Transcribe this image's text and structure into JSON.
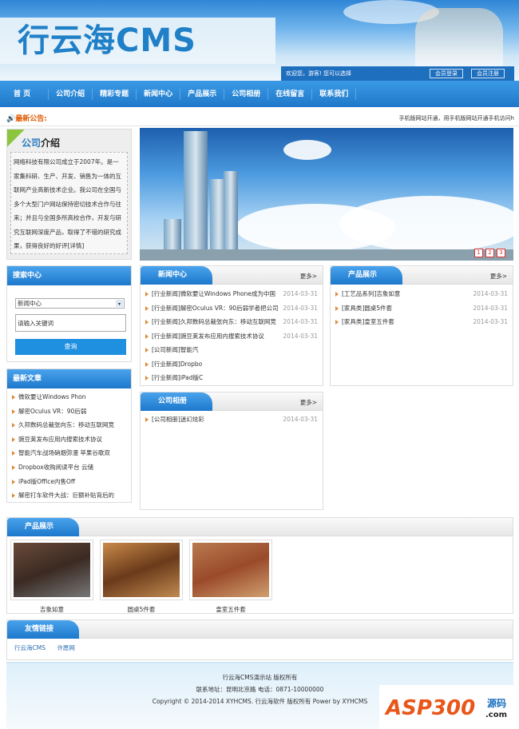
{
  "header": {
    "logo": "行云海CMS",
    "welcome": "欢迎您，游客! 您可以选择",
    "login": "会员登录",
    "register": "会员注册"
  },
  "nav": [
    "首 页",
    "公司介绍",
    "精彩专题",
    "新闻中心",
    "产品展示",
    "公司相册",
    "在线留言",
    "联系我们"
  ],
  "notice": {
    "label": "最新公告:",
    "text": "手机版网站开通，用手机版网站开通手机访问h"
  },
  "intro": {
    "title_a": "公司",
    "title_b": "介绍",
    "body": "网络科技有限公司成立于2007年。是一家集科研、生产、开发、销售为一体的互联网产业高新技术企业。我公司在全国与多个大型门户网站保持密切技术合作与往来；并且与全国多所高校合作，开发与研究互联网深度产品，取得了不错的研究成果，获得良好的好评[详情]"
  },
  "banner": {
    "slides": [
      "1",
      "2",
      "3"
    ]
  },
  "search": {
    "title": "搜索中心",
    "select": "新闻中心",
    "placeholder": "请输入关键词",
    "button": "查询"
  },
  "latest": {
    "title": "最新文章",
    "items": [
      "微软要让Windows Phon",
      "解密Oculus VR：90后弱",
      "久邦数码总裁张向东：移动互联网竞",
      "豌豆荚发布应用内搜索技术协议",
      "智能汽车战场硝烟弥漫 苹果谷歌双",
      "Dropbox收购阅读平台 云储",
      "iPad版Office内售Off",
      "解密打车软件大战：巨额补贴背后的"
    ]
  },
  "news": {
    "title": "新闻中心",
    "more": "更多>",
    "items": [
      {
        "t": "[行业新闻]微软要让Windows Phone成为中国",
        "d": "2014-03-31"
      },
      {
        "t": "[行业新闻]解密Oculus VR：90后弱学者把公司",
        "d": "2014-03-31"
      },
      {
        "t": "[行业新闻]久邦数码总裁张向东：移动互联网竞",
        "d": "2014-03-31"
      },
      {
        "t": "[行业新闻]豌豆荚发布应用内搜索技术协议",
        "d": "2014-03-31"
      },
      {
        "t": "[公司新闻]智能汽",
        "d": ""
      },
      {
        "t": "[行业新闻]Dropbo",
        "d": ""
      },
      {
        "t": "[行业新闻]iPad版C",
        "d": ""
      }
    ]
  },
  "products_list": {
    "title": "产品展示",
    "more": "更多>",
    "items": [
      {
        "t": "[工艺品系列]吉象如意",
        "d": "2014-03-31"
      },
      {
        "t": "[家具类]圆桌5件套",
        "d": "2014-03-31"
      },
      {
        "t": "[家具类]皇室五件套",
        "d": "2014-03-31"
      }
    ]
  },
  "album": {
    "title": "公司相册",
    "more": "更多>",
    "items": [
      {
        "t": "[公司相册]迷幻炫彩",
        "d": "2014-03-31"
      }
    ]
  },
  "products_show": {
    "title": "产品展示",
    "items": [
      "吉象如意",
      "圆桌5件套",
      "皇室五件套"
    ]
  },
  "links": {
    "title": "友情链接",
    "items": [
      "行云海CMS",
      "许愿网"
    ]
  },
  "footer": {
    "line1": "行云海CMS演示站 版权所有",
    "line2": "联系地址：昆明北京路 电话：0871-10000000",
    "line3": "Copyright © 2014-2014 XYHCMS. 行云海软件 版权所有  Power by XYHCMS"
  },
  "watermark": "ASP300源码 .com"
}
